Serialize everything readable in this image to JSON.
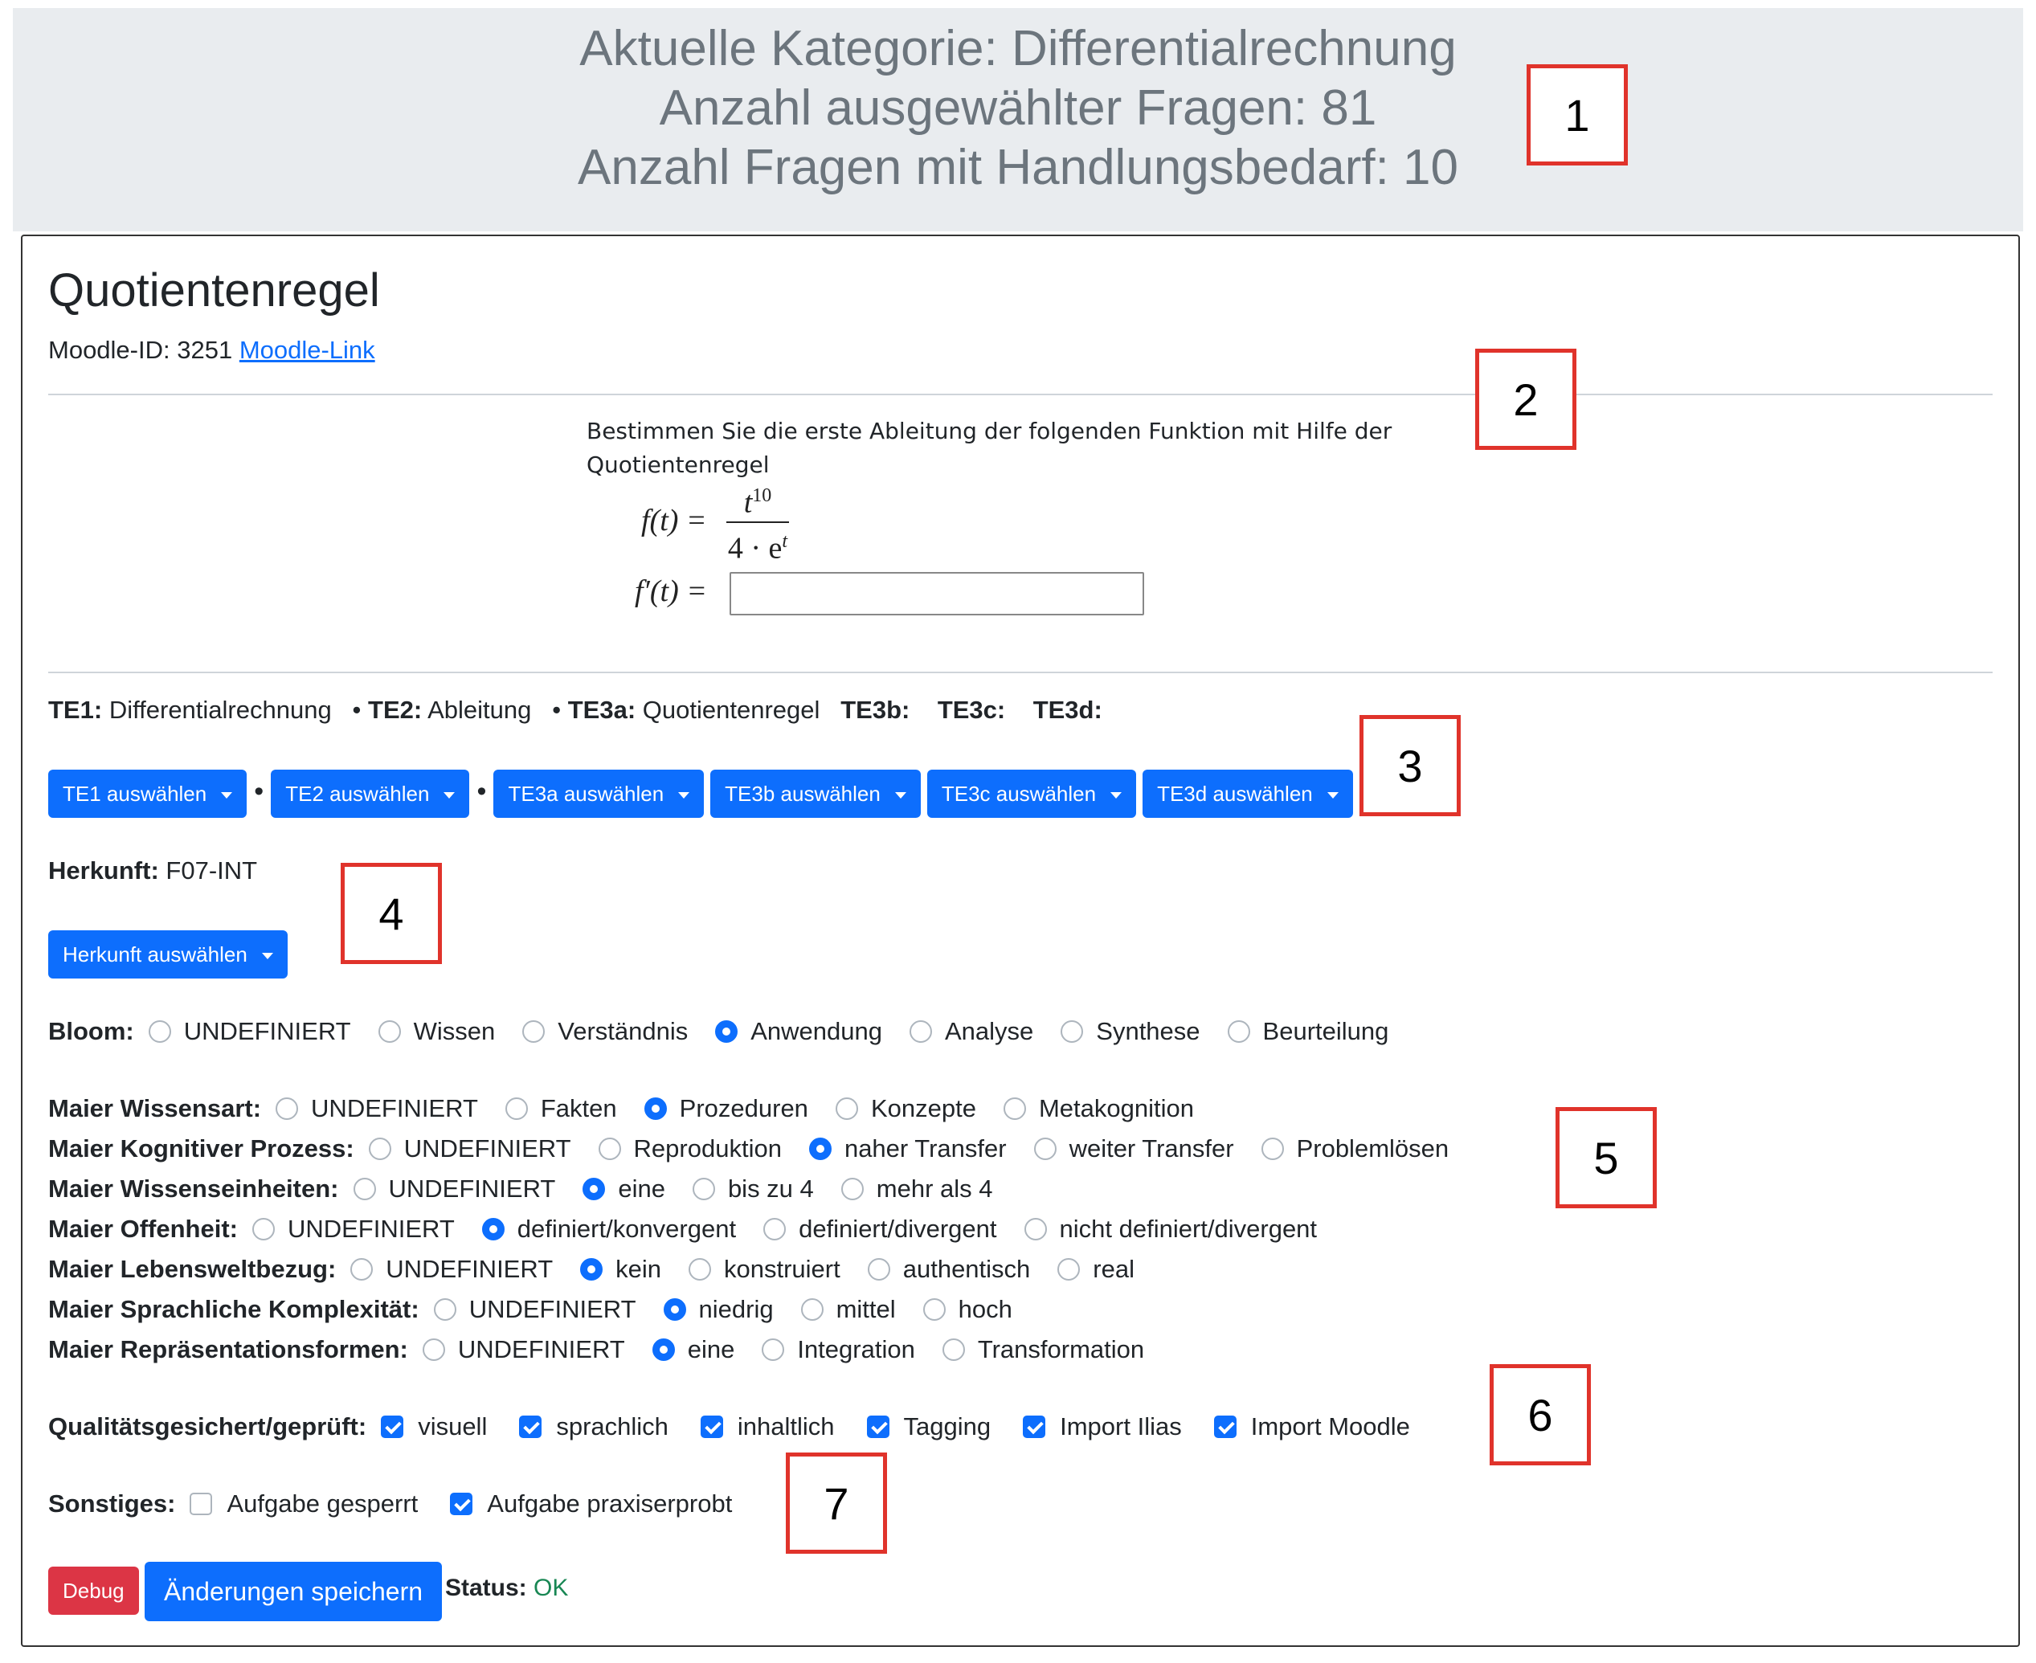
{
  "header": {
    "line1": "Aktuelle Kategorie: Differentialrechnung",
    "line2": "Anzahl ausgewählter Fragen: 81",
    "line3": "Anzahl Fragen mit Handlungsbedarf: 10"
  },
  "question": {
    "title": "Quotientenregel",
    "moodle_id_label": "Moodle-ID: 3251",
    "moodle_link": "Moodle-Link",
    "text": "Bestimmen Sie die erste Ableitung der folgenden Funktion mit Hilfe der Quotientenregel",
    "formula_lhs": "f(t) =",
    "formula_num": "t",
    "formula_exp": "10",
    "formula_den": "4 · e",
    "formula_den_exp": "t",
    "answer_lhs": "f′(t) =",
    "answer_value": ""
  },
  "te": {
    "te1_label": "TE1:",
    "te1_value": "Differentialrechnung",
    "te2_label": "TE2:",
    "te2_value": "Ableitung",
    "te3a_label": "TE3a:",
    "te3a_value": "Quotientenregel",
    "te3b_label": "TE3b:",
    "te3c_label": "TE3c:",
    "te3d_label": "TE3d:",
    "sep": "•"
  },
  "te_buttons": {
    "te1": "TE1 auswählen",
    "te2": "TE2 auswählen",
    "te3a": "TE3a auswählen",
    "te3b": "TE3b auswählen",
    "te3c": "TE3c auswählen",
    "te3d": "TE3d auswählen"
  },
  "herkunft": {
    "label": "Herkunft:",
    "value": "F07-INT",
    "button": "Herkunft auswählen"
  },
  "bloom": {
    "label": "Bloom:",
    "options": [
      "UNDEFINIERT",
      "Wissen",
      "Verständnis",
      "Anwendung",
      "Analyse",
      "Synthese",
      "Beurteilung"
    ],
    "selected": "Anwendung"
  },
  "maier": {
    "wissensart": {
      "label": "Maier Wissensart:",
      "options": [
        "UNDEFINIERT",
        "Fakten",
        "Prozeduren",
        "Konzepte",
        "Metakognition"
      ],
      "selected": "Prozeduren"
    },
    "kognitiv": {
      "label": "Maier Kognitiver Prozess:",
      "options": [
        "UNDEFINIERT",
        "Reproduktion",
        "naher Transfer",
        "weiter Transfer",
        "Problemlösen"
      ],
      "selected": "naher Transfer"
    },
    "einheiten": {
      "label": "Maier Wissenseinheiten:",
      "options": [
        "UNDEFINIERT",
        "eine",
        "bis zu 4",
        "mehr als 4"
      ],
      "selected": "eine"
    },
    "offenheit": {
      "label": "Maier Offenheit:",
      "options": [
        "UNDEFINIERT",
        "definiert/konvergent",
        "definiert/divergent",
        "nicht definiert/divergent"
      ],
      "selected": "definiert/konvergent"
    },
    "lebenswelt": {
      "label": "Maier Lebensweltbezug:",
      "options": [
        "UNDEFINIERT",
        "kein",
        "konstruiert",
        "authentisch",
        "real"
      ],
      "selected": "kein"
    },
    "sprache": {
      "label": "Maier Sprachliche Komplexität:",
      "options": [
        "UNDEFINIERT",
        "niedrig",
        "mittel",
        "hoch"
      ],
      "selected": "niedrig"
    },
    "repr": {
      "label": "Maier Repräsentationsformen:",
      "options": [
        "UNDEFINIERT",
        "eine",
        "Integration",
        "Transformation"
      ],
      "selected": "eine"
    }
  },
  "qs": {
    "label": "Qualitätsgesichert/geprüft:",
    "items": [
      {
        "text": "visuell",
        "checked": true
      },
      {
        "text": "sprachlich",
        "checked": true
      },
      {
        "text": "inhaltlich",
        "checked": true
      },
      {
        "text": "Tagging",
        "checked": true
      },
      {
        "text": "Import Ilias",
        "checked": true
      },
      {
        "text": "Import Moodle",
        "checked": true
      }
    ]
  },
  "sonstiges": {
    "label": "Sonstiges:",
    "items": [
      {
        "text": "Aufgabe gesperrt",
        "checked": false
      },
      {
        "text": "Aufgabe praxiserprobt",
        "checked": true
      }
    ]
  },
  "actions": {
    "debug": "Debug",
    "save": "Änderungen speichern",
    "status_label": "Status:",
    "status_value": "OK"
  },
  "annotations": [
    "1",
    "2",
    "3",
    "4",
    "5",
    "6",
    "7"
  ],
  "colors": {
    "primary": "#0d6efd",
    "danger": "#dc3545",
    "success": "#198754",
    "annotation": "#e0332b",
    "header_bg": "#e9ecef"
  }
}
